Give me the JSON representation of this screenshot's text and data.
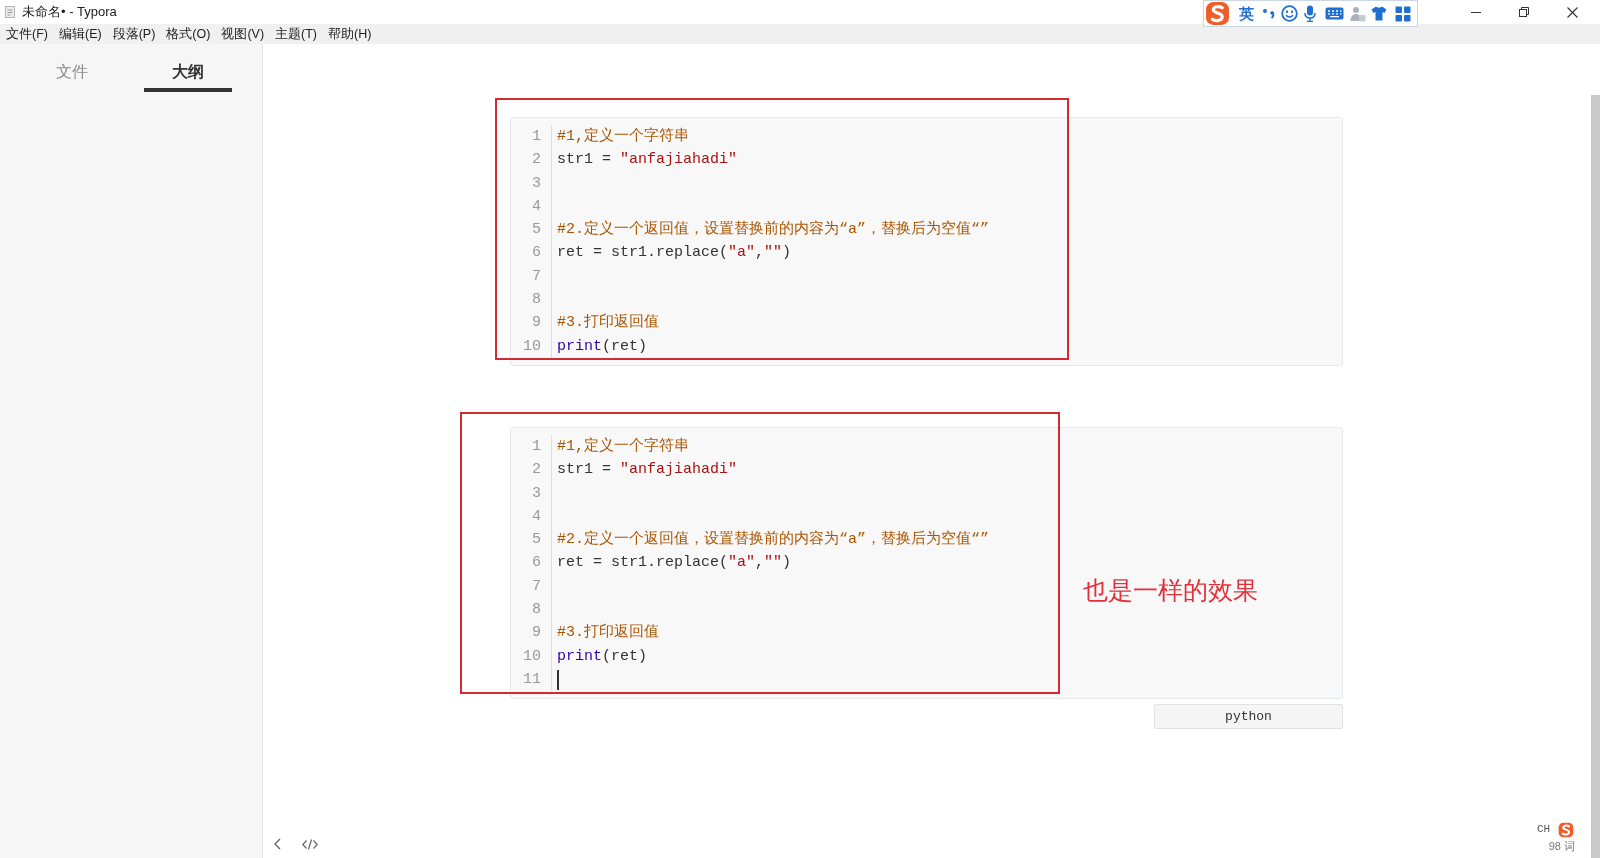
{
  "window": {
    "title": "未命名• - Typora"
  },
  "ime_toolbar": {
    "mode": "英"
  },
  "menu_bar": [
    {
      "label": "文件(F)"
    },
    {
      "label": "编辑(E)"
    },
    {
      "label": "段落(P)"
    },
    {
      "label": "格式(O)"
    },
    {
      "label": "视图(V)"
    },
    {
      "label": "主题(T)"
    },
    {
      "label": "帮助(H)"
    }
  ],
  "sidebar": {
    "tabs": [
      {
        "label": "文件",
        "selected": false
      },
      {
        "label": "大纲",
        "selected": true
      }
    ]
  },
  "code_blocks": [
    {
      "lines": [
        {
          "number": "1",
          "cursor": false,
          "tokens": [
            {
              "kind": "comment",
              "text": "#1,定义一个字符串"
            }
          ]
        },
        {
          "number": "2",
          "cursor": false,
          "tokens": [
            {
              "kind": "plain",
              "text": "str1 = "
            },
            {
              "kind": "string",
              "text": "\"anfajiahadi\""
            }
          ]
        },
        {
          "number": "3",
          "cursor": false
        },
        {
          "number": "4",
          "cursor": false
        },
        {
          "number": "5",
          "cursor": false,
          "tokens": [
            {
              "kind": "comment",
              "text": "#2.定义一个返回值，设置替换前的内容为“a”，替换后为空值“”"
            }
          ]
        },
        {
          "number": "6",
          "cursor": false,
          "tokens": [
            {
              "kind": "plain",
              "text": "ret = str1.replace("
            },
            {
              "kind": "string",
              "text": "\"a\""
            },
            {
              "kind": "plain",
              "text": ","
            },
            {
              "kind": "string",
              "text": "\"\""
            },
            {
              "kind": "plain",
              "text": ")"
            }
          ]
        },
        {
          "number": "7",
          "cursor": false
        },
        {
          "number": "8",
          "cursor": false
        },
        {
          "number": "9",
          "cursor": false,
          "tokens": [
            {
              "kind": "comment",
              "text": "#3.打印返回值"
            }
          ]
        },
        {
          "number": "10",
          "cursor": false,
          "tokens": [
            {
              "kind": "builtin",
              "text": "print"
            },
            {
              "kind": "plain",
              "text": "(ret)"
            }
          ]
        }
      ],
      "annotations": [
        {
          "kind": "frame"
        }
      ]
    },
    {
      "lines": [
        {
          "number": "1",
          "cursor": false,
          "tokens": [
            {
              "kind": "comment",
              "text": "#1,定义一个字符串"
            }
          ]
        },
        {
          "number": "2",
          "cursor": false,
          "tokens": [
            {
              "kind": "plain",
              "text": "str1 = "
            },
            {
              "kind": "string",
              "text": "\"anfajiahadi\""
            }
          ]
        },
        {
          "number": "3",
          "cursor": false
        },
        {
          "number": "4",
          "cursor": false
        },
        {
          "number": "5",
          "cursor": false,
          "tokens": [
            {
              "kind": "comment",
              "text": "#2.定义一个返回值，设置替换前的内容为“a”，替换后为空值“”"
            }
          ]
        },
        {
          "number": "6",
          "cursor": false,
          "tokens": [
            {
              "kind": "plain",
              "text": "ret = str1.replace("
            },
            {
              "kind": "string",
              "text": "\"a\""
            },
            {
              "kind": "plain",
              "text": ","
            },
            {
              "kind": "string",
              "text": "\"\""
            },
            {
              "kind": "plain",
              "text": ")"
            }
          ]
        },
        {
          "number": "7",
          "cursor": false
        },
        {
          "number": "8",
          "cursor": false
        },
        {
          "number": "9",
          "cursor": false,
          "tokens": [
            {
              "kind": "comment",
              "text": "#3.打印返回值"
            }
          ]
        },
        {
          "number": "10",
          "cursor": false,
          "tokens": [
            {
              "kind": "builtin",
              "text": "print"
            },
            {
              "kind": "plain",
              "text": "(ret)"
            }
          ]
        },
        {
          "number": "11",
          "cursor": true
        }
      ],
      "annotations": [
        {
          "kind": "frame"
        },
        {
          "kind": "note",
          "text": "也是一样的效果"
        }
      ],
      "language": "python"
    }
  ],
  "status_bar": {
    "word_count": "98 词"
  },
  "ime_status": {
    "label": "CH"
  }
}
